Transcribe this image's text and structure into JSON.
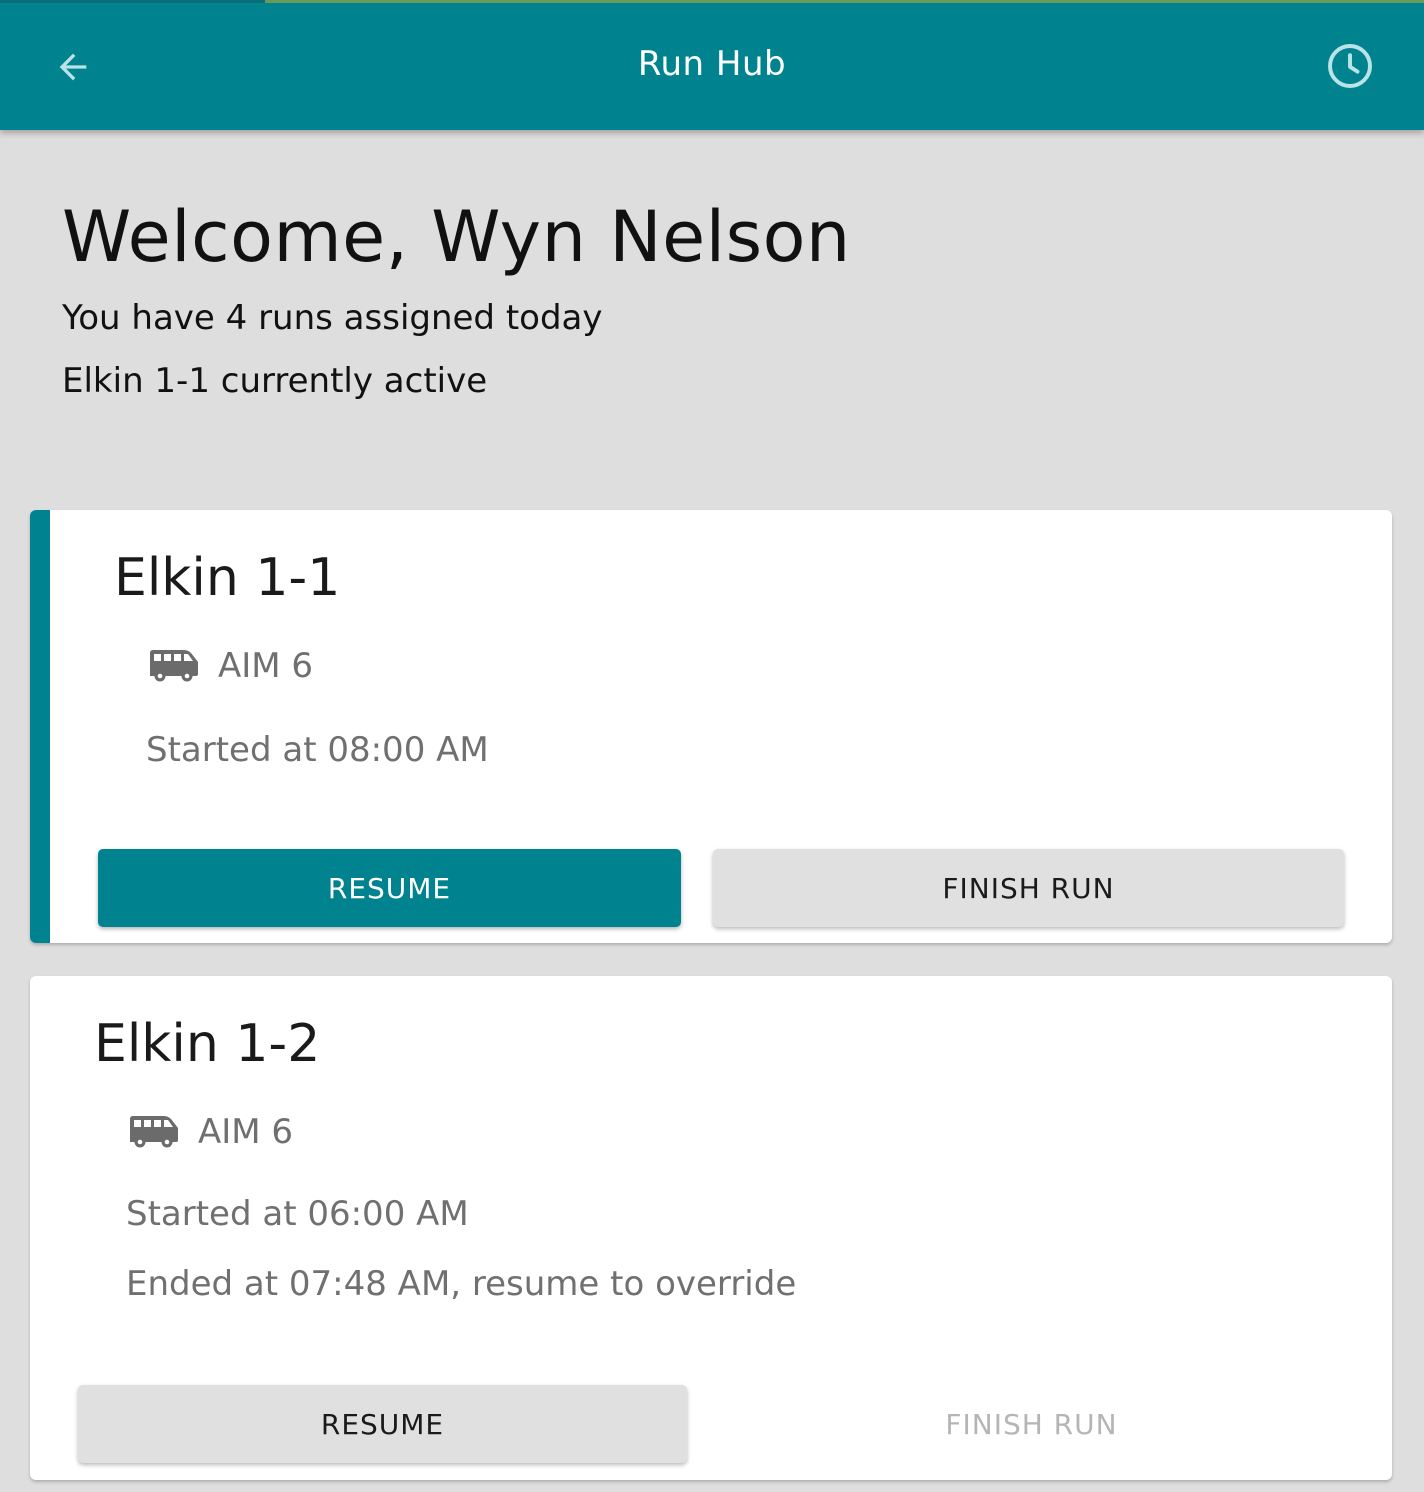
{
  "appbar": {
    "title": "Run Hub",
    "back_icon": "arrow-left-icon",
    "history_icon": "clock-icon",
    "color": "#00838f"
  },
  "welcome": {
    "heading": "Welcome, Wyn Nelson",
    "runs_assigned": "You have 4 runs assigned today",
    "active_run": "Elkin 1-1 currently active"
  },
  "runs": [
    {
      "name": "Elkin 1-1",
      "vehicle_icon": "bus-icon",
      "vehicle": "AIM 6",
      "started": "Started at 08:00 AM",
      "active": true,
      "resume_label": "RESUME",
      "finish_label": "FINISH RUN",
      "finish_enabled": true
    },
    {
      "name": "Elkin 1-2",
      "vehicle_icon": "bus-icon",
      "vehicle": "AIM 6",
      "started": "Started at 06:00 AM",
      "ended": "Ended at 07:48 AM, resume to override",
      "active": false,
      "resume_label": "RESUME",
      "finish_label": "FINISH RUN",
      "finish_enabled": false
    }
  ]
}
